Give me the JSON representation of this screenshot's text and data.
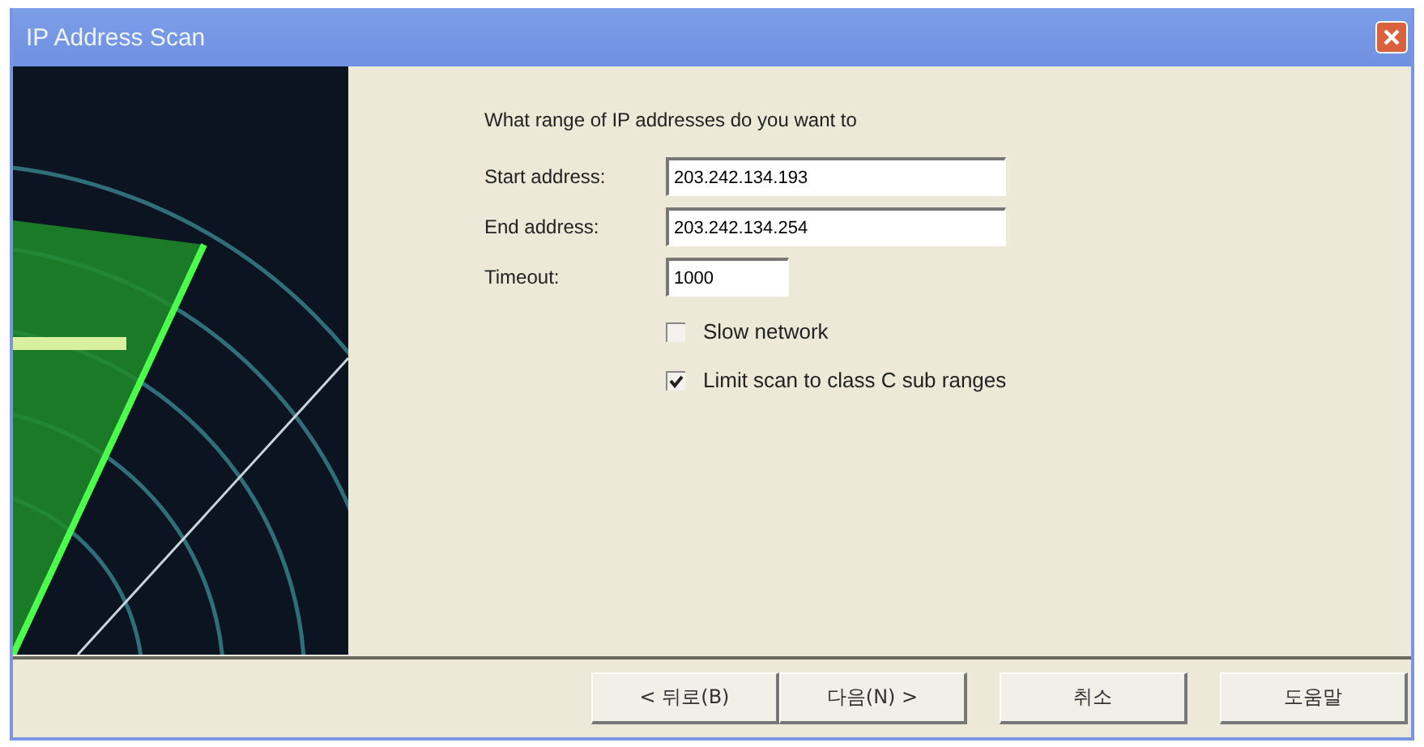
{
  "window": {
    "title": "IP Address Scan"
  },
  "prompt": "What range of IP addresses do you want to",
  "fields": [
    {
      "label": "Start address:",
      "value": "203.242.134.193",
      "kind": "wide"
    },
    {
      "label": "End address:",
      "value": "203.242.134.254",
      "kind": "wide"
    },
    {
      "label": "Timeout:",
      "value": "1000",
      "kind": "narrow"
    }
  ],
  "options": [
    {
      "label": "Slow network",
      "checked": false
    },
    {
      "label": "Limit scan to class C sub ranges",
      "checked": true
    }
  ],
  "buttons": [
    "< 뒤로(B)",
    "다음(N) >",
    "취소",
    "도움말"
  ]
}
